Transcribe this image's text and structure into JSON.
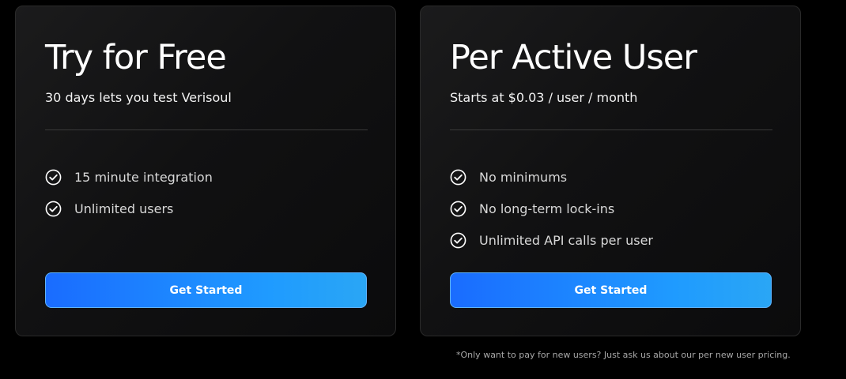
{
  "plans": [
    {
      "title": "Try for Free",
      "subtitle": "30 days lets you test Verisoul",
      "features": [
        "15 minute integration",
        "Unlimited users"
      ],
      "cta_label": "Get Started"
    },
    {
      "title": "Per Active User",
      "subtitle": "Starts at $0.03 / user / month",
      "features": [
        "No minimums",
        "No long-term lock-ins",
        "Unlimited API calls per user"
      ],
      "cta_label": "Get Started"
    }
  ],
  "footnote": "*Only want to pay for new users? Just ask us about our per new user pricing.",
  "icons": {
    "feature_icon": "check-circle-icon"
  },
  "colors": {
    "background": "#000000",
    "card_border": "#2a2a2a",
    "cta_start": "#1a6cff",
    "cta_end": "#2aa6f5",
    "text_primary": "#ffffff",
    "text_secondary": "#d8d8d8"
  }
}
